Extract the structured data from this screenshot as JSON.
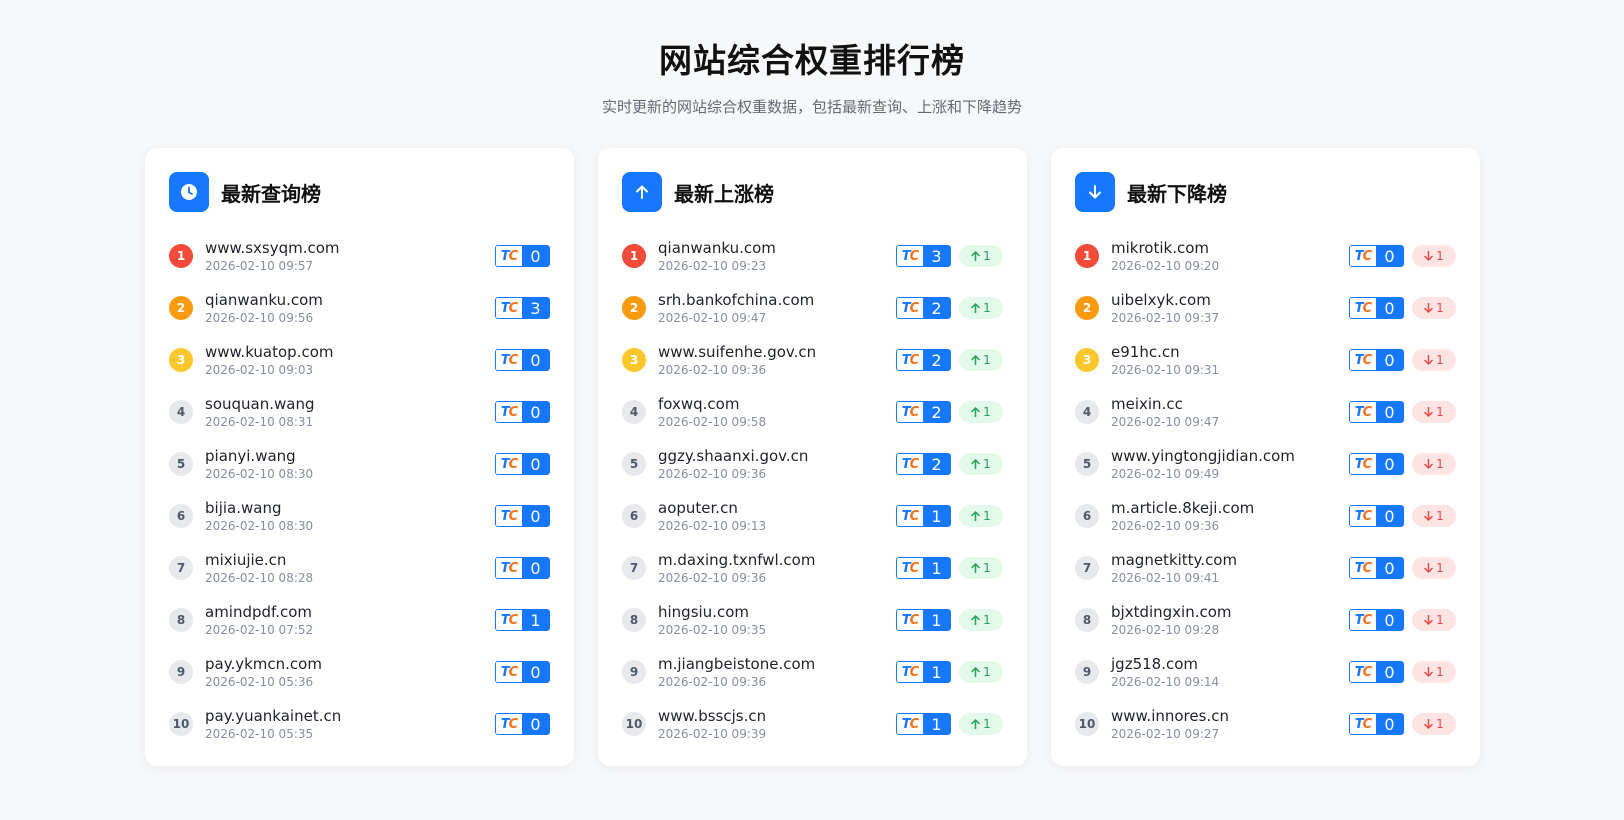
{
  "header": {
    "title": "网站综合权重排行榜",
    "subtitle": "实时更新的网站综合权重数据，包括最新查询、上涨和下降趋势"
  },
  "colors": {
    "accent": "#1677ff",
    "rank1": "#f24b3a",
    "rank2": "#fa9a0e",
    "rank3": "#fcc72c",
    "up": "#22a55a",
    "down": "#f04848"
  },
  "boards": [
    {
      "title": "最新查询榜",
      "icon": "clock-icon",
      "kind": "query",
      "items": [
        {
          "rank": "1",
          "domain": "www.sxsyqm.com",
          "time": "2026-02-10 09:57",
          "weight": "0"
        },
        {
          "rank": "2",
          "domain": "qianwanku.com",
          "time": "2026-02-10 09:56",
          "weight": "3"
        },
        {
          "rank": "3",
          "domain": "www.kuatop.com",
          "time": "2026-02-10 09:03",
          "weight": "0"
        },
        {
          "rank": "4",
          "domain": "souquan.wang",
          "time": "2026-02-10 08:31",
          "weight": "0"
        },
        {
          "rank": "5",
          "domain": "pianyi.wang",
          "time": "2026-02-10 08:30",
          "weight": "0"
        },
        {
          "rank": "6",
          "domain": "bijia.wang",
          "time": "2026-02-10 08:30",
          "weight": "0"
        },
        {
          "rank": "7",
          "domain": "mixiujie.cn",
          "time": "2026-02-10 08:28",
          "weight": "0"
        },
        {
          "rank": "8",
          "domain": "amindpdf.com",
          "time": "2026-02-10 07:52",
          "weight": "1"
        },
        {
          "rank": "9",
          "domain": "pay.ykmcn.com",
          "time": "2026-02-10 05:36",
          "weight": "0"
        },
        {
          "rank": "10",
          "domain": "pay.yuankainet.cn",
          "time": "2026-02-10 05:35",
          "weight": "0"
        }
      ]
    },
    {
      "title": "最新上涨榜",
      "icon": "arrow-up-icon",
      "kind": "up",
      "items": [
        {
          "rank": "1",
          "domain": "qianwanku.com",
          "time": "2026-02-10 09:23",
          "weight": "3",
          "change": "1"
        },
        {
          "rank": "2",
          "domain": "srh.bankofchina.com",
          "time": "2026-02-10 09:47",
          "weight": "2",
          "change": "1"
        },
        {
          "rank": "3",
          "domain": "www.suifenhe.gov.cn",
          "time": "2026-02-10 09:36",
          "weight": "2",
          "change": "1"
        },
        {
          "rank": "4",
          "domain": "foxwq.com",
          "time": "2026-02-10 09:58",
          "weight": "2",
          "change": "1"
        },
        {
          "rank": "5",
          "domain": "ggzy.shaanxi.gov.cn",
          "time": "2026-02-10 09:36",
          "weight": "2",
          "change": "1"
        },
        {
          "rank": "6",
          "domain": "aoputer.cn",
          "time": "2026-02-10 09:13",
          "weight": "1",
          "change": "1"
        },
        {
          "rank": "7",
          "domain": "m.daxing.txnfwl.com",
          "time": "2026-02-10 09:36",
          "weight": "1",
          "change": "1"
        },
        {
          "rank": "8",
          "domain": "hingsiu.com",
          "time": "2026-02-10 09:35",
          "weight": "1",
          "change": "1"
        },
        {
          "rank": "9",
          "domain": "m.jiangbeistone.com",
          "time": "2026-02-10 09:36",
          "weight": "1",
          "change": "1"
        },
        {
          "rank": "10",
          "domain": "www.bsscjs.cn",
          "time": "2026-02-10 09:39",
          "weight": "1",
          "change": "1"
        }
      ]
    },
    {
      "title": "最新下降榜",
      "icon": "arrow-down-icon",
      "kind": "down",
      "items": [
        {
          "rank": "1",
          "domain": "mikrotik.com",
          "time": "2026-02-10 09:20",
          "weight": "0",
          "change": "1"
        },
        {
          "rank": "2",
          "domain": "uibelxyk.com",
          "time": "2026-02-10 09:37",
          "weight": "0",
          "change": "1"
        },
        {
          "rank": "3",
          "domain": "e91hc.cn",
          "time": "2026-02-10 09:31",
          "weight": "0",
          "change": "1"
        },
        {
          "rank": "4",
          "domain": "meixin.cc",
          "time": "2026-02-10 09:47",
          "weight": "0",
          "change": "1"
        },
        {
          "rank": "5",
          "domain": "www.yingtongjidian.com",
          "time": "2026-02-10 09:49",
          "weight": "0",
          "change": "1"
        },
        {
          "rank": "6",
          "domain": "m.article.8keji.com",
          "time": "2026-02-10 09:36",
          "weight": "0",
          "change": "1"
        },
        {
          "rank": "7",
          "domain": "magnetkitty.com",
          "time": "2026-02-10 09:41",
          "weight": "0",
          "change": "1"
        },
        {
          "rank": "8",
          "domain": "bjxtdingxin.com",
          "time": "2026-02-10 09:28",
          "weight": "0",
          "change": "1"
        },
        {
          "rank": "9",
          "domain": "jgz518.com",
          "time": "2026-02-10 09:14",
          "weight": "0",
          "change": "1"
        },
        {
          "rank": "10",
          "domain": "www.innores.cn",
          "time": "2026-02-10 09:27",
          "weight": "0",
          "change": "1"
        }
      ]
    }
  ]
}
